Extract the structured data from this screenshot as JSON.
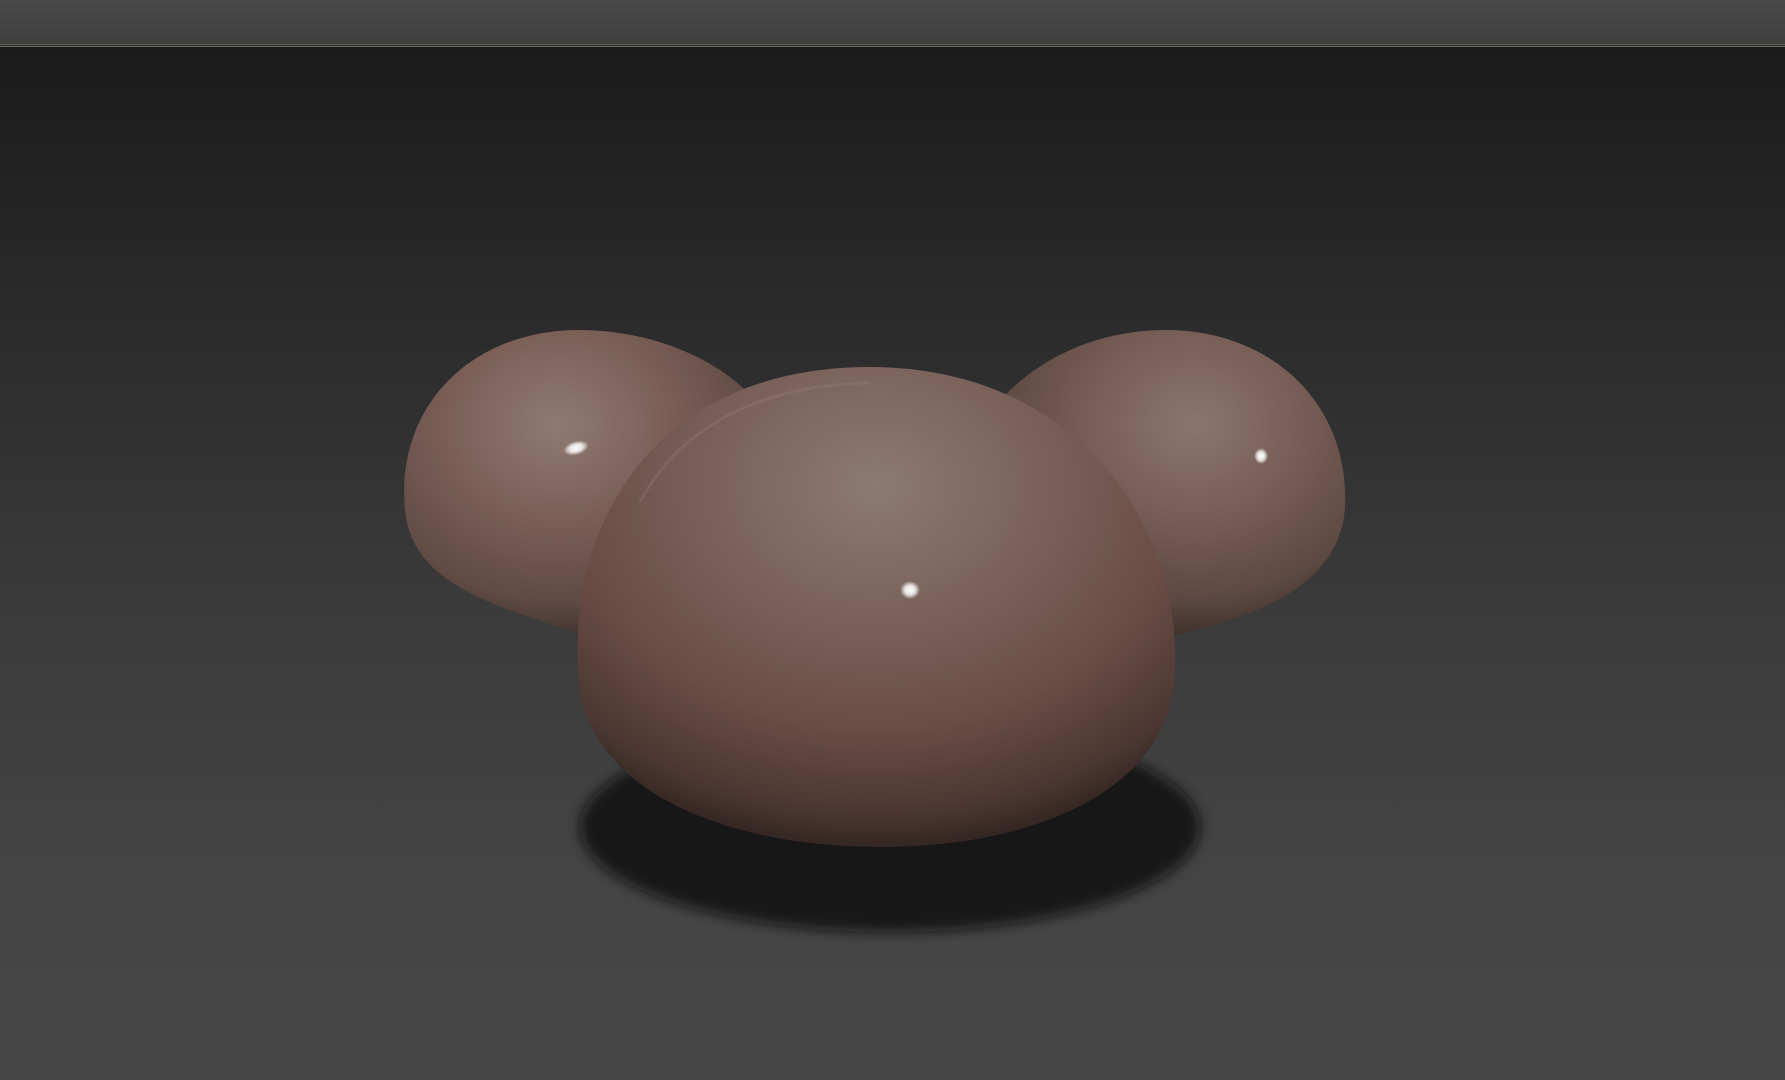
{
  "viewport": {
    "background_top": "#1b1b1b",
    "background_bottom": "#474747"
  },
  "model": {
    "base_color": "#7a5f57",
    "highlight_color": "#8f7a72",
    "shadow_color": "#2b1f1b"
  }
}
